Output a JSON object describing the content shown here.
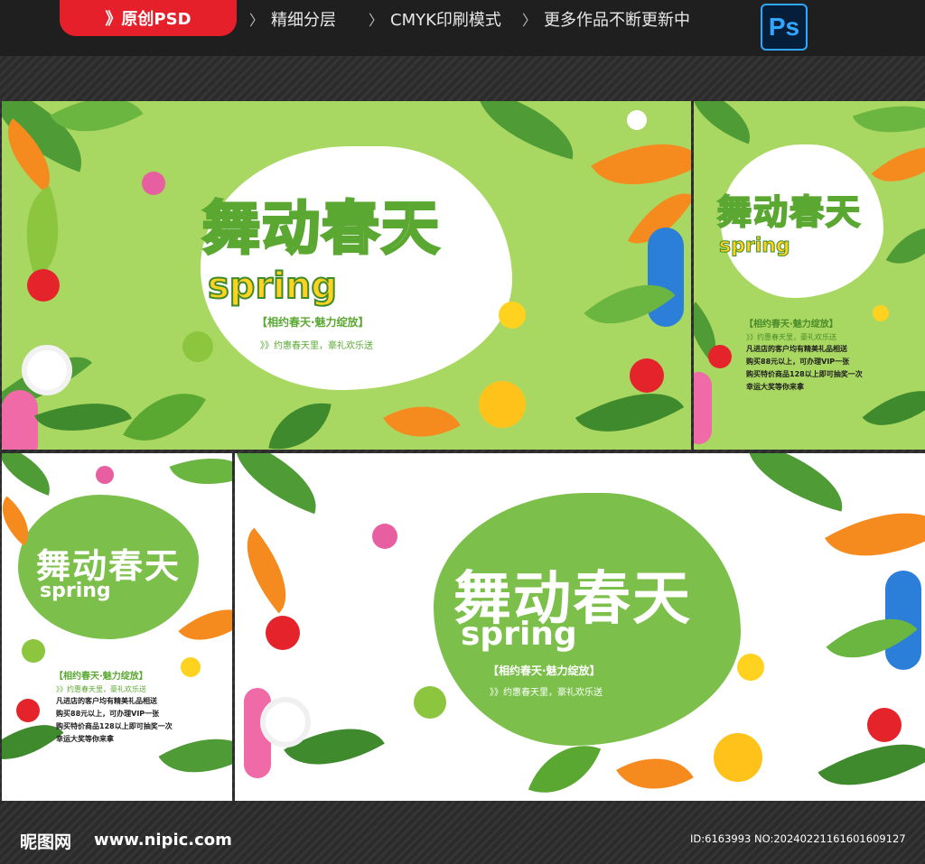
{
  "topbar": {
    "badge": "》原创PSD",
    "items": [
      "精细分层",
      "CMYK印刷模式",
      "更多作品不断更新中"
    ],
    "ps_label": "Ps"
  },
  "poster": {
    "title": "舞动春天",
    "spring": "spring",
    "tagline": "【相约春天·魅力绽放】",
    "subline": "》》约惠春天里，豪礼欢乐送",
    "bullets": [
      "凡进店的客户均有精美礼品相送",
      "购买88元以上，可办理VIP一张",
      "购买特价商品128以上即可抽奖一次",
      "幸运大奖等你来拿"
    ]
  },
  "colors": {
    "green_bg": "#a9d862",
    "blob_green": "#7cc04b",
    "title_green": "#5aa832",
    "accent_yellow": "#ffd21f",
    "orange": "#f58b1f",
    "red": "#e5232a"
  },
  "footer": {
    "logo": "昵图网",
    "url": "www.nipic.com",
    "id": "ID:6163993 NO:20240221161601609127"
  }
}
